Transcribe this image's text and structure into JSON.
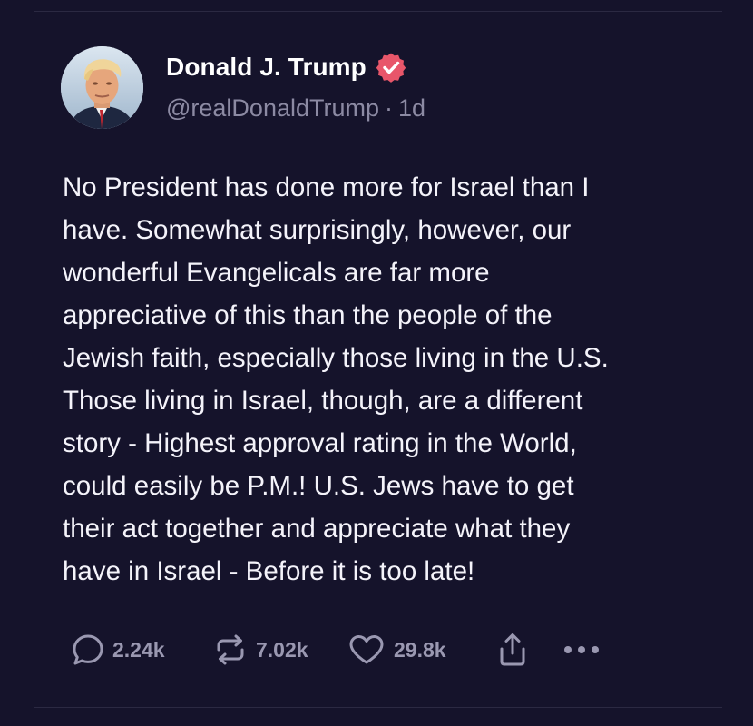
{
  "colors": {
    "background": "#15132b",
    "text": "#f4f3fa",
    "muted": "#8c8aa3",
    "verified_badge": "#e8566a",
    "icon": "#9a98b1"
  },
  "post": {
    "author": {
      "display_name": "Donald J. Trump",
      "handle": "@realDonaldTrump",
      "verified_icon": "verified-badge-icon",
      "avatar": "profile-photo"
    },
    "separator": "·",
    "time_ago": "1d",
    "text": "No President has done more for Israel than I\nhave. Somewhat surprisingly, however, our\nwonderful Evangelicals are far more\nappreciative of this than the people of the\nJewish faith, especially those living in the U.S.\nThose living in Israel, though, are a different\nstory - Highest approval rating in the World,\ncould easily be P.M.! U.S. Jews have to get\ntheir act together and appreciate what they\nhave in Israel - Before it is too late!",
    "actions": {
      "replies": {
        "icon": "comment-icon",
        "count": "2.24k"
      },
      "reposts": {
        "icon": "repost-icon",
        "count": "7.02k"
      },
      "likes": {
        "icon": "heart-icon",
        "count": "29.8k"
      },
      "share": {
        "icon": "share-icon"
      },
      "more": {
        "icon": "more-dots-icon"
      }
    }
  }
}
